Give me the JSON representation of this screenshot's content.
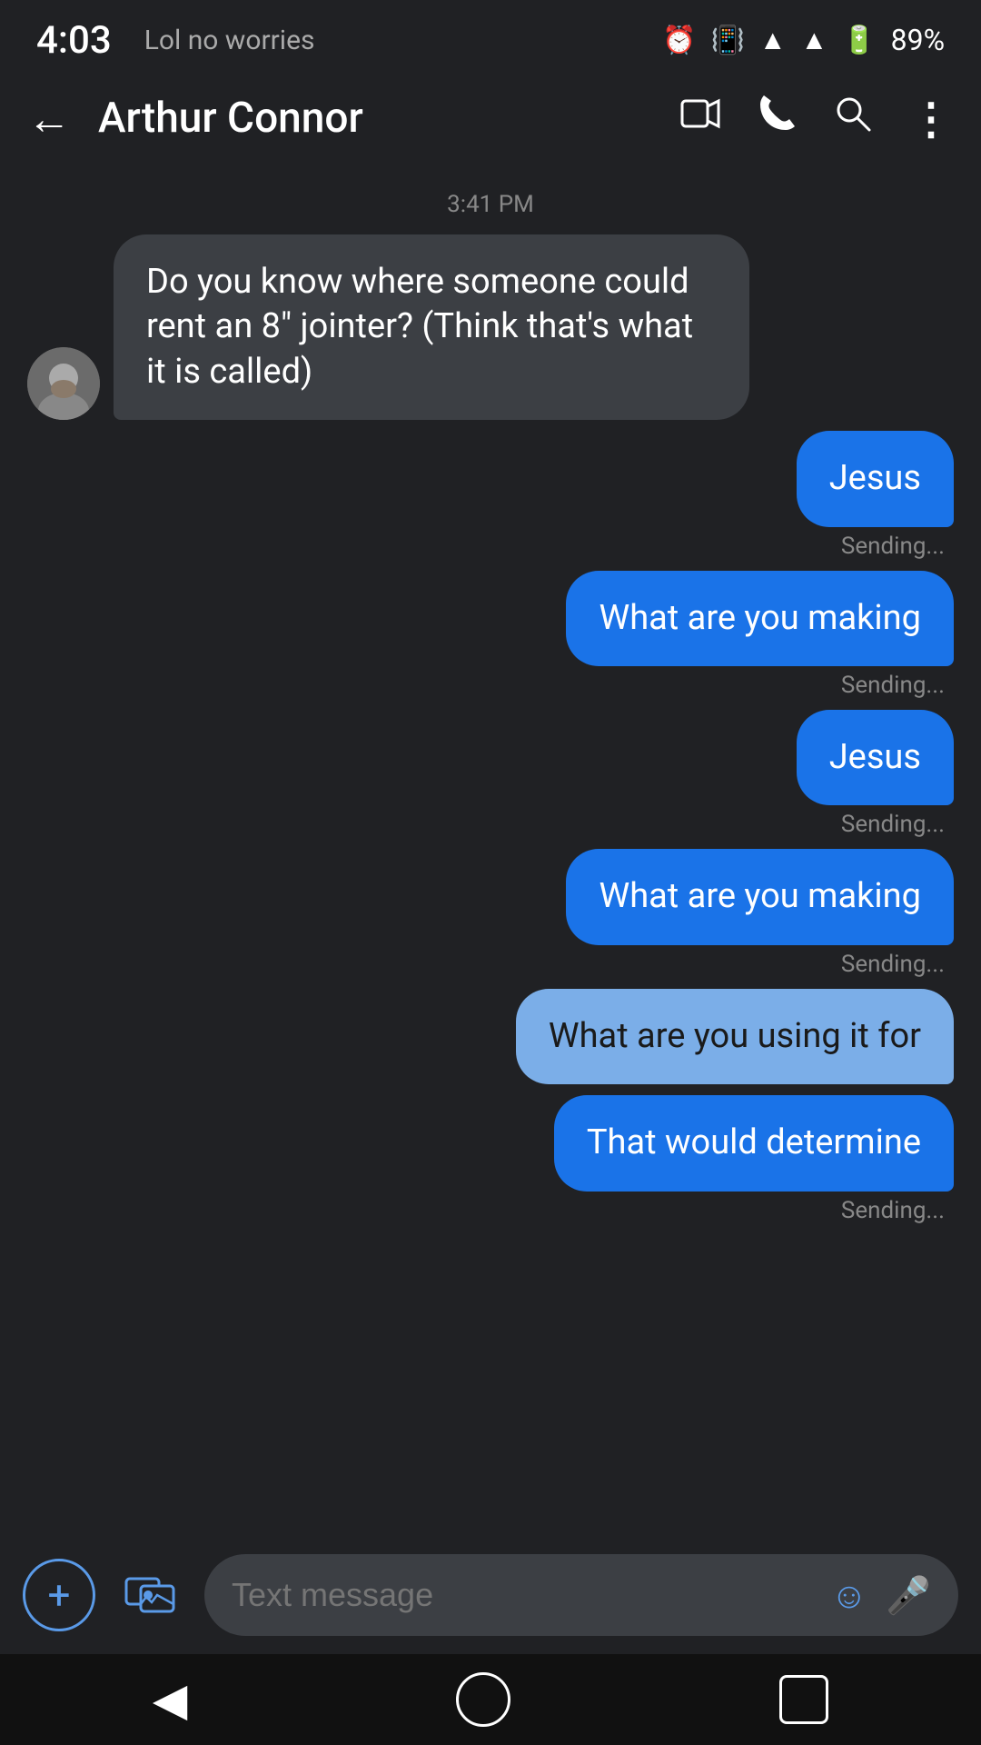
{
  "status_bar": {
    "time": "4:03",
    "notification": "Lol no worries",
    "battery": "89%"
  },
  "app_bar": {
    "title": "Arthur Connor",
    "back_label": "←"
  },
  "chat": {
    "timestamp": "3:41 PM",
    "messages": [
      {
        "id": "msg1",
        "type": "received",
        "text": "Do you know where someone could rent an 8\" jointer? (Think that's what it is called)",
        "has_avatar": true,
        "status": null
      },
      {
        "id": "msg2",
        "type": "sent",
        "text": "Jesus",
        "style": "blue",
        "status": "Sending..."
      },
      {
        "id": "msg3",
        "type": "sent",
        "text": "What are you making",
        "style": "blue",
        "status": "Sending..."
      },
      {
        "id": "msg4",
        "type": "sent",
        "text": "Jesus",
        "style": "blue",
        "status": "Sending..."
      },
      {
        "id": "msg5",
        "type": "sent",
        "text": "What are you making",
        "style": "blue",
        "status": "Sending..."
      },
      {
        "id": "msg6",
        "type": "sent",
        "text": "What are you using it for",
        "style": "light",
        "status": null
      },
      {
        "id": "msg7",
        "type": "sent",
        "text": "That would determine",
        "style": "blue",
        "status": "Sending..."
      }
    ]
  },
  "input": {
    "placeholder": "Text message"
  },
  "icons": {
    "back": "←",
    "video": "▭",
    "phone": "✆",
    "search": "⌕",
    "more": "⋮",
    "add": "+",
    "gallery": "🖼",
    "emoji": "☺",
    "mic": "🎤"
  }
}
